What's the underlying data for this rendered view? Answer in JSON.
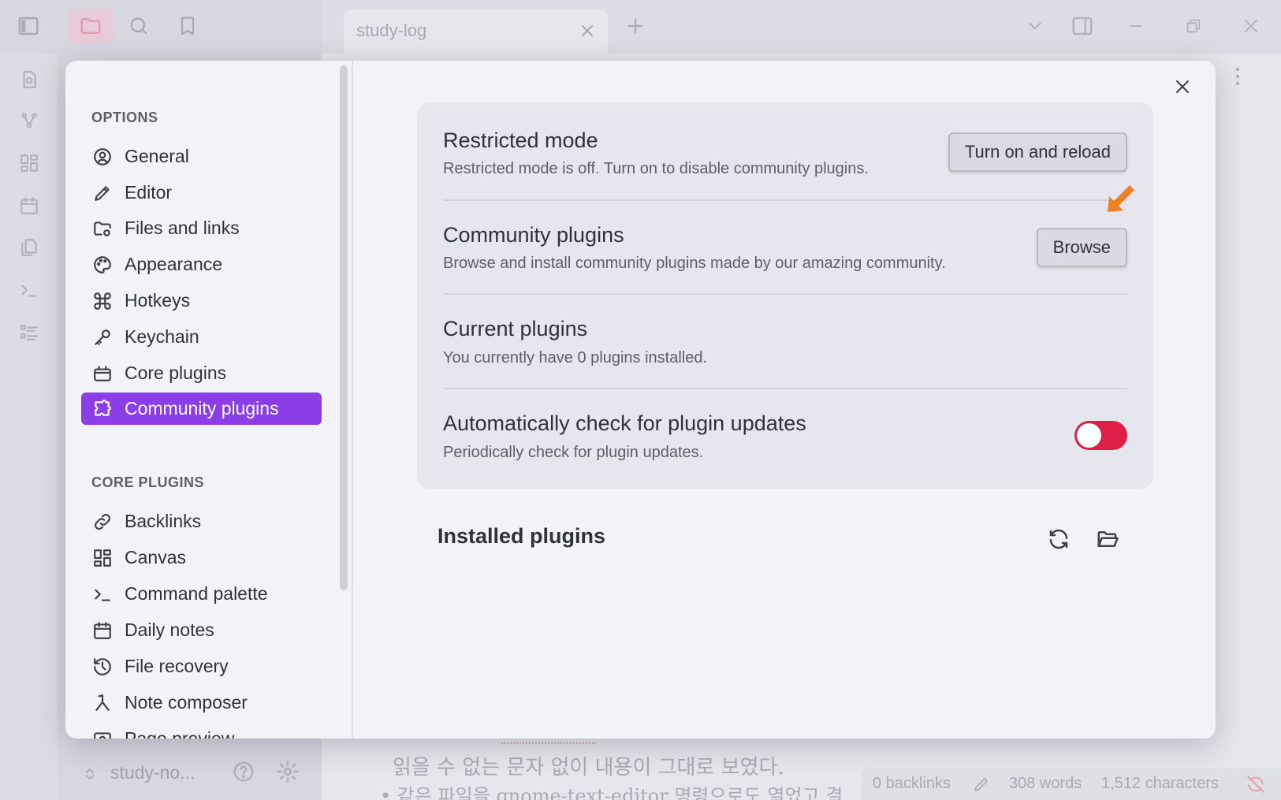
{
  "window": {
    "tab_title": "study-log"
  },
  "footer": {
    "vault_name": "study-no...",
    "status_backlinks": "0 backlinks",
    "status_words": "308 words",
    "status_chars": "1,512 characters"
  },
  "background_text": {
    "line1": "읽을 수 없는 문자 없이 내용이 그대로 보였다.",
    "line2": "• 같은 파일을 gnome-text-editor 명령으로도 열었고 결"
  },
  "settings_nav": {
    "options_heading": "OPTIONS",
    "options_items": [
      {
        "label": "General",
        "icon": "user-circle-icon"
      },
      {
        "label": "Editor",
        "icon": "pencil-icon"
      },
      {
        "label": "Files and links",
        "icon": "folder-cog-icon"
      },
      {
        "label": "Appearance",
        "icon": "palette-icon"
      },
      {
        "label": "Hotkeys",
        "icon": "command-icon"
      },
      {
        "label": "Keychain",
        "icon": "key-icon"
      },
      {
        "label": "Core plugins",
        "icon": "plug-box-icon"
      },
      {
        "label": "Community plugins",
        "icon": "puzzle-icon",
        "active": true
      }
    ],
    "core_heading": "CORE PLUGINS",
    "core_items": [
      {
        "label": "Backlinks",
        "icon": "link-icon"
      },
      {
        "label": "Canvas",
        "icon": "layout-grid-icon"
      },
      {
        "label": "Command palette",
        "icon": "terminal-icon"
      },
      {
        "label": "Daily notes",
        "icon": "calendar-icon"
      },
      {
        "label": "File recovery",
        "icon": "history-icon"
      },
      {
        "label": "Note composer",
        "icon": "merge-icon"
      },
      {
        "label": "Page preview",
        "icon": "preview-icon"
      }
    ]
  },
  "community_plugins": {
    "restricted": {
      "name": "Restricted mode",
      "desc": "Restricted mode is off. Turn on to disable community plugins.",
      "button": "Turn on and reload"
    },
    "community": {
      "name": "Community plugins",
      "desc": "Browse and install community plugins made by our amazing community.",
      "button": "Browse"
    },
    "current": {
      "name": "Current plugins",
      "desc": "You currently have 0 plugins installed."
    },
    "auto_update": {
      "name": "Automatically check for plugin updates",
      "desc": "Periodically check for plugin updates.",
      "toggle_on": false
    },
    "installed_title": "Installed plugins"
  },
  "colors": {
    "accent": "#8b3ee8",
    "toggle_off_red": "#df1f48",
    "hint_arrow": "#f07f26"
  }
}
